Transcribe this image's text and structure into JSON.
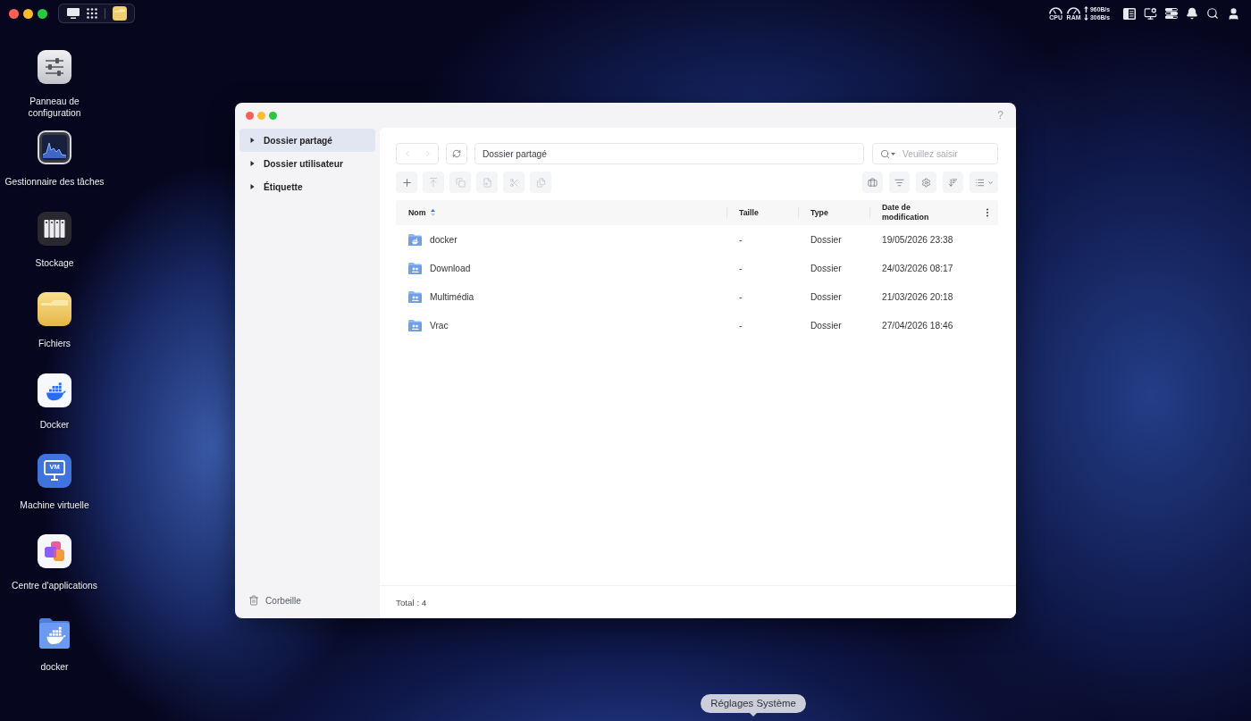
{
  "menu_bar": {
    "monitors": [
      {
        "label": "CPU"
      },
      {
        "label": "RAM"
      }
    ],
    "network": [
      {
        "kind": "upload",
        "speed": "960B/s"
      },
      {
        "kind": "download",
        "speed": "306B/s"
      }
    ]
  },
  "desktop_icons": [
    {
      "kind": "control-panel",
      "label": "Panneau de configuration"
    },
    {
      "kind": "task-manager",
      "label": "Gestionnaire des tâches"
    },
    {
      "kind": "storage",
      "label": "Stockage"
    },
    {
      "kind": "files",
      "label": "Fichiers"
    },
    {
      "kind": "docker",
      "label": "Docker"
    },
    {
      "kind": "vm",
      "label": "Machine virtuelle",
      "icon_text": "VM"
    },
    {
      "kind": "app-center",
      "label": "Centre d'applications"
    },
    {
      "kind": "docker-folder",
      "label": "docker"
    }
  ],
  "window": {
    "help": "?",
    "sidebar": {
      "items": [
        {
          "label": "Dossier partagé",
          "selected": true,
          "expanded": false
        },
        {
          "label": "Dossier utilisateur",
          "selected": false,
          "expanded": false
        },
        {
          "label": "Étiquette",
          "selected": false,
          "expanded": false
        }
      ],
      "trash": "Corbeille"
    },
    "nav": [
      {
        "kind": "back",
        "disabled": true
      },
      {
        "kind": "forward",
        "disabled": true
      }
    ],
    "path": "Dossier partagé",
    "search": {
      "placeholder": "Veuillez saisir"
    },
    "actions": [
      {
        "kind": "add",
        "disabled": false
      },
      {
        "kind": "upload",
        "disabled": true
      },
      {
        "kind": "copy",
        "disabled": true
      },
      {
        "kind": "paste",
        "disabled": true
      },
      {
        "kind": "cut",
        "disabled": true
      },
      {
        "kind": "duplicate",
        "disabled": true
      }
    ],
    "tools": [
      {
        "kind": "briefcase"
      },
      {
        "kind": "filter"
      },
      {
        "kind": "settings"
      },
      {
        "kind": "sort"
      },
      {
        "kind": "view"
      }
    ],
    "table": {
      "columns": [
        {
          "label": "Nom",
          "sorted": true
        },
        {
          "label": "Taille",
          "sorted": false
        },
        {
          "label": "Type",
          "sorted": false
        },
        {
          "label": "Date de modification",
          "sorted": false
        }
      ],
      "rows": [
        {
          "kind": "app",
          "name": "docker",
          "size": "-",
          "type": "Dossier",
          "modified": "19/05/2026 23:38"
        },
        {
          "kind": "shared",
          "name": "Download",
          "size": "-",
          "type": "Dossier",
          "modified": "24/03/2026 08:17"
        },
        {
          "kind": "shared",
          "name": "Multimédia",
          "size": "-",
          "type": "Dossier",
          "modified": "21/03/2026 20:18"
        },
        {
          "kind": "shared",
          "name": "Vrac",
          "size": "-",
          "type": "Dossier",
          "modified": "27/04/2026 18:46"
        }
      ]
    },
    "footer": "Total : 4"
  },
  "tooltip": "Réglages Système"
}
